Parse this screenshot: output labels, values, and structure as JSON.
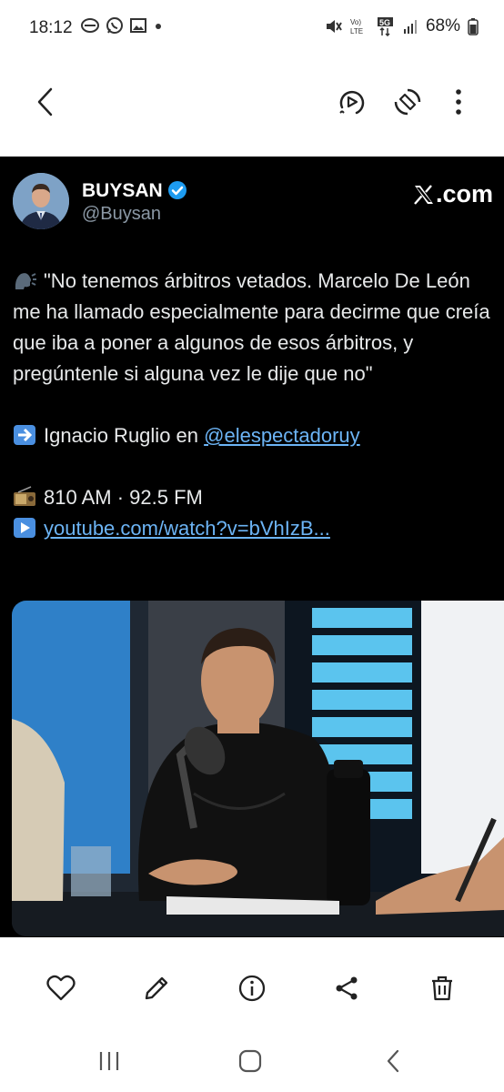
{
  "status_bar": {
    "time": "18:12",
    "battery": "68%",
    "left_icons": [
      "phone-storage-icon",
      "whatsapp-icon",
      "gallery-icon",
      "dot-icon"
    ],
    "right_icons": [
      "mute-icon",
      "volte-icon",
      "5g-icon",
      "signal-icon",
      "battery-icon"
    ]
  },
  "app_bar": {
    "icons": [
      "back-arrow-icon",
      "remaster-icon",
      "rotate-icon",
      "more-options-icon"
    ]
  },
  "tweet": {
    "author_name": "BUYSAN",
    "author_handle": "@Buysan",
    "source_logo_text": ".com",
    "quote_line": "\"No tenemos árbitros vetados. Marcelo De León me ha llamado especialmente para decirme que creía que iba a poner a algunos de esos árbitros, y pregúntenle si alguna vez le dije que no\"",
    "attribution_prefix": "Ignacio Ruglio en ",
    "attribution_link": "@elespectadoruy",
    "radio_line": "810 AM · 92.5 FM",
    "video_link": "youtube.com/watch?v=bVhIzB...",
    "emojis": [
      "speaking-head-emoji",
      "right-arrow-emoji",
      "radio-emoji",
      "play-button-emoji"
    ],
    "colors": {
      "background": "#000000",
      "text": "#e7e9ea",
      "link": "#6cb4f5",
      "verified": "#1d9bf0"
    }
  },
  "bottom_bar": {
    "icons": [
      "heart-icon",
      "edit-pencil-icon",
      "info-icon",
      "share-icon",
      "trash-icon"
    ]
  },
  "nav_bar": {
    "icons": [
      "recent-apps-icon",
      "home-icon",
      "back-icon"
    ]
  }
}
